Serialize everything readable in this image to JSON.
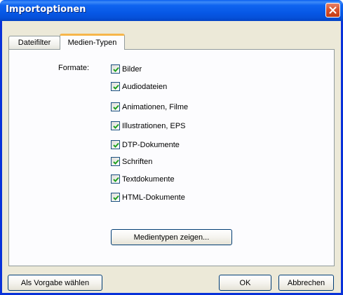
{
  "window": {
    "title": "Importoptionen"
  },
  "tabs": [
    {
      "label": "Dateifilter",
      "active": false
    },
    {
      "label": "Medien-Typen",
      "active": true
    }
  ],
  "formate": {
    "label": "Formate:",
    "options": [
      {
        "label": "Bilder",
        "checked": true
      },
      {
        "label": "Audiodateien",
        "checked": true
      },
      {
        "label": "Animationen, Filme",
        "checked": true
      },
      {
        "label": "Illustrationen, EPS",
        "checked": true
      },
      {
        "label": "DTP-Dokumente",
        "checked": true
      },
      {
        "label": "Schriften",
        "checked": true
      },
      {
        "label": "Textdokumente",
        "checked": true
      },
      {
        "label": "HTML-Dokumente",
        "checked": true
      }
    ]
  },
  "buttons": {
    "show_media_types": "Medientypen zeigen...",
    "set_default": "Als Vorgabe wählen",
    "ok": "OK",
    "cancel": "Abbrechen"
  },
  "colors": {
    "titlebar": "#0550d8",
    "dialog_face": "#ece9d8",
    "active_tab_accent": "#f7b64a",
    "checkmark": "#21a121",
    "close_button": "#d9532f"
  },
  "icons": {
    "close": "close-icon",
    "checkmark": "checkmark-icon"
  }
}
